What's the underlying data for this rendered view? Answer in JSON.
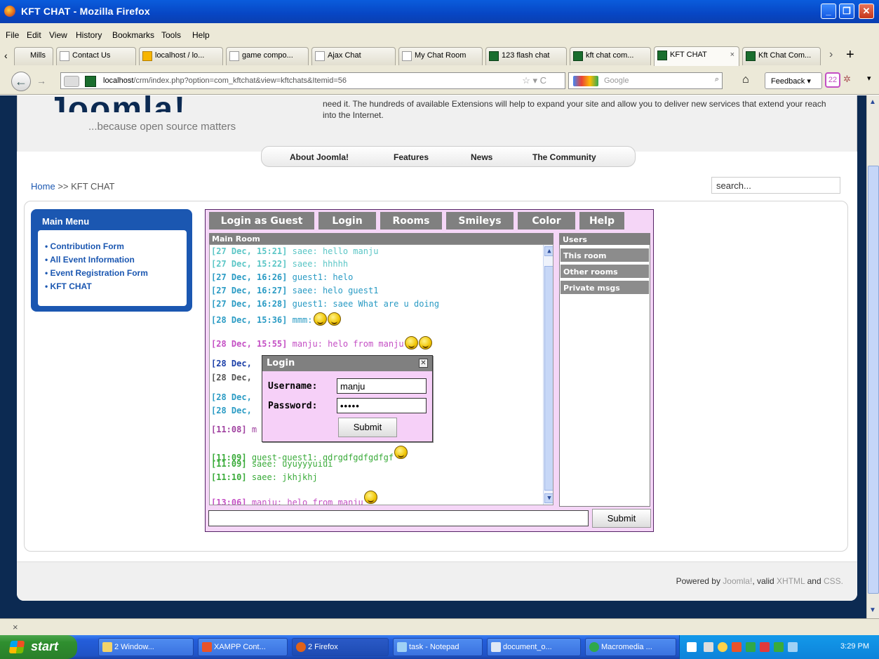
{
  "window": {
    "title": "KFT CHAT - Mozilla Firefox",
    "buttons": [
      "_",
      "❐",
      "✕"
    ]
  },
  "menu": [
    "File",
    "Edit",
    "View",
    "History",
    "Bookmarks",
    "Tools",
    "Help"
  ],
  "tabs": [
    {
      "label": "Mills"
    },
    {
      "label": "Contact Us"
    },
    {
      "label": "localhost / lo..."
    },
    {
      "label": "game compo..."
    },
    {
      "label": "Ajax Chat"
    },
    {
      "label": "My Chat Room"
    },
    {
      "label": "123 flash chat"
    },
    {
      "label": "kft chat com..."
    },
    {
      "label": "KFT CHAT"
    },
    {
      "label": "Kft Chat Com..."
    }
  ],
  "nav": {
    "url_host": "localhost",
    "url_rest": "/crm/index.php?option=com_kftchat&view=kftchats&Itemid=56",
    "search_placeholder": "Google",
    "feedback": "Feedback",
    "badge": "22"
  },
  "site": {
    "logo": "Joomla!",
    "tagline": "...because open source matters",
    "header_text": "need it. The hundreds of available Extensions will help to expand your site and allow you to deliver new services that extend your reach into the Internet.",
    "topnav": [
      "About Joomla!",
      "Features",
      "News",
      "The Community"
    ],
    "breadcrumb_home": "Home",
    "breadcrumb_sep": ">>",
    "breadcrumb_current": "KFT CHAT",
    "search_value": "search..."
  },
  "mainmenu": {
    "title": "Main Menu",
    "items": [
      "Contribution Form",
      "All Event Information",
      "Event Registration Form",
      "KFT CHAT"
    ]
  },
  "chat": {
    "tabs": [
      "Login as Guest",
      "Login",
      "Rooms",
      "Smileys",
      "Color",
      "Help"
    ],
    "room": "Main Room",
    "users_header": "Users",
    "user_buttons": [
      "This room",
      "Other rooms",
      "Private msgs"
    ],
    "submit": "Submit",
    "messages": [
      {
        "ts": "[27 Dec, 15:21]",
        "text": "saee: hello manju",
        "color": "#5bc6c6"
      },
      {
        "ts": "[27 Dec, 15:22]",
        "text": "saee: hhhhh",
        "color": "#5bc6c6"
      },
      {
        "ts": "[27 Dec, 16:26]",
        "text": "guest1: helo",
        "color": "#2a9bc4"
      },
      {
        "ts": "[27 Dec, 16:27]",
        "text": "saee: helo guest1",
        "color": "#2a9bc4"
      },
      {
        "ts": "[27 Dec, 16:28]",
        "text": "guest1: saee What are u doing",
        "color": "#2a9bc4"
      },
      {
        "ts": "[28 Dec, 15:36]",
        "text": "mmm:",
        "color": "#2a9bc4"
      },
      {
        "ts": "[28 Dec, 15:55]",
        "text": "manju: helo from manju",
        "color": "#c44fc4"
      },
      {
        "ts": "[28 Dec,",
        "text": "",
        "color": "#1b3fa8"
      },
      {
        "ts": "[28 Dec,",
        "text": "",
        "color": "#555555"
      },
      {
        "ts": "[28 Dec,",
        "text": "",
        "color": "#2a9bc4"
      },
      {
        "ts": "[28 Dec,",
        "text": "",
        "color": "#2a9bc4"
      },
      {
        "ts": "[11:08]",
        "text": "m",
        "color": "#a042a0"
      },
      {
        "ts": "[11:09]",
        "text": "guest-guest1: gdrgdfgdfgdfgf",
        "color": "#3aab3a"
      },
      {
        "ts": "[11:09]",
        "text": "saee: uyuyyyuiui",
        "color": "#3aab3a"
      },
      {
        "ts": "[11:10]",
        "text": "saee: jkhjkhj",
        "color": "#3aab3a"
      },
      {
        "ts": "[13:06]",
        "text": "manju: helo from manju",
        "color": "#c44fc4"
      }
    ]
  },
  "login": {
    "title": "Login",
    "username_label": "Username:",
    "username_value": "manju",
    "password_label": "Password:",
    "password_value": "•••••",
    "submit": "Submit"
  },
  "footer": {
    "powered": "Powered by",
    "joomla": "Joomla!",
    "valid": ", valid",
    "xhtml": "XHTML",
    "and": "and",
    "css": "CSS."
  },
  "findbar": {
    "close": "×"
  },
  "taskbar": {
    "start": "start",
    "tasks": [
      "2 Window...",
      "XAMPP Cont...",
      "2 Firefox",
      "task - Notepad",
      "document_o...",
      "Macromedia ..."
    ],
    "clock": "3:29 PM"
  }
}
